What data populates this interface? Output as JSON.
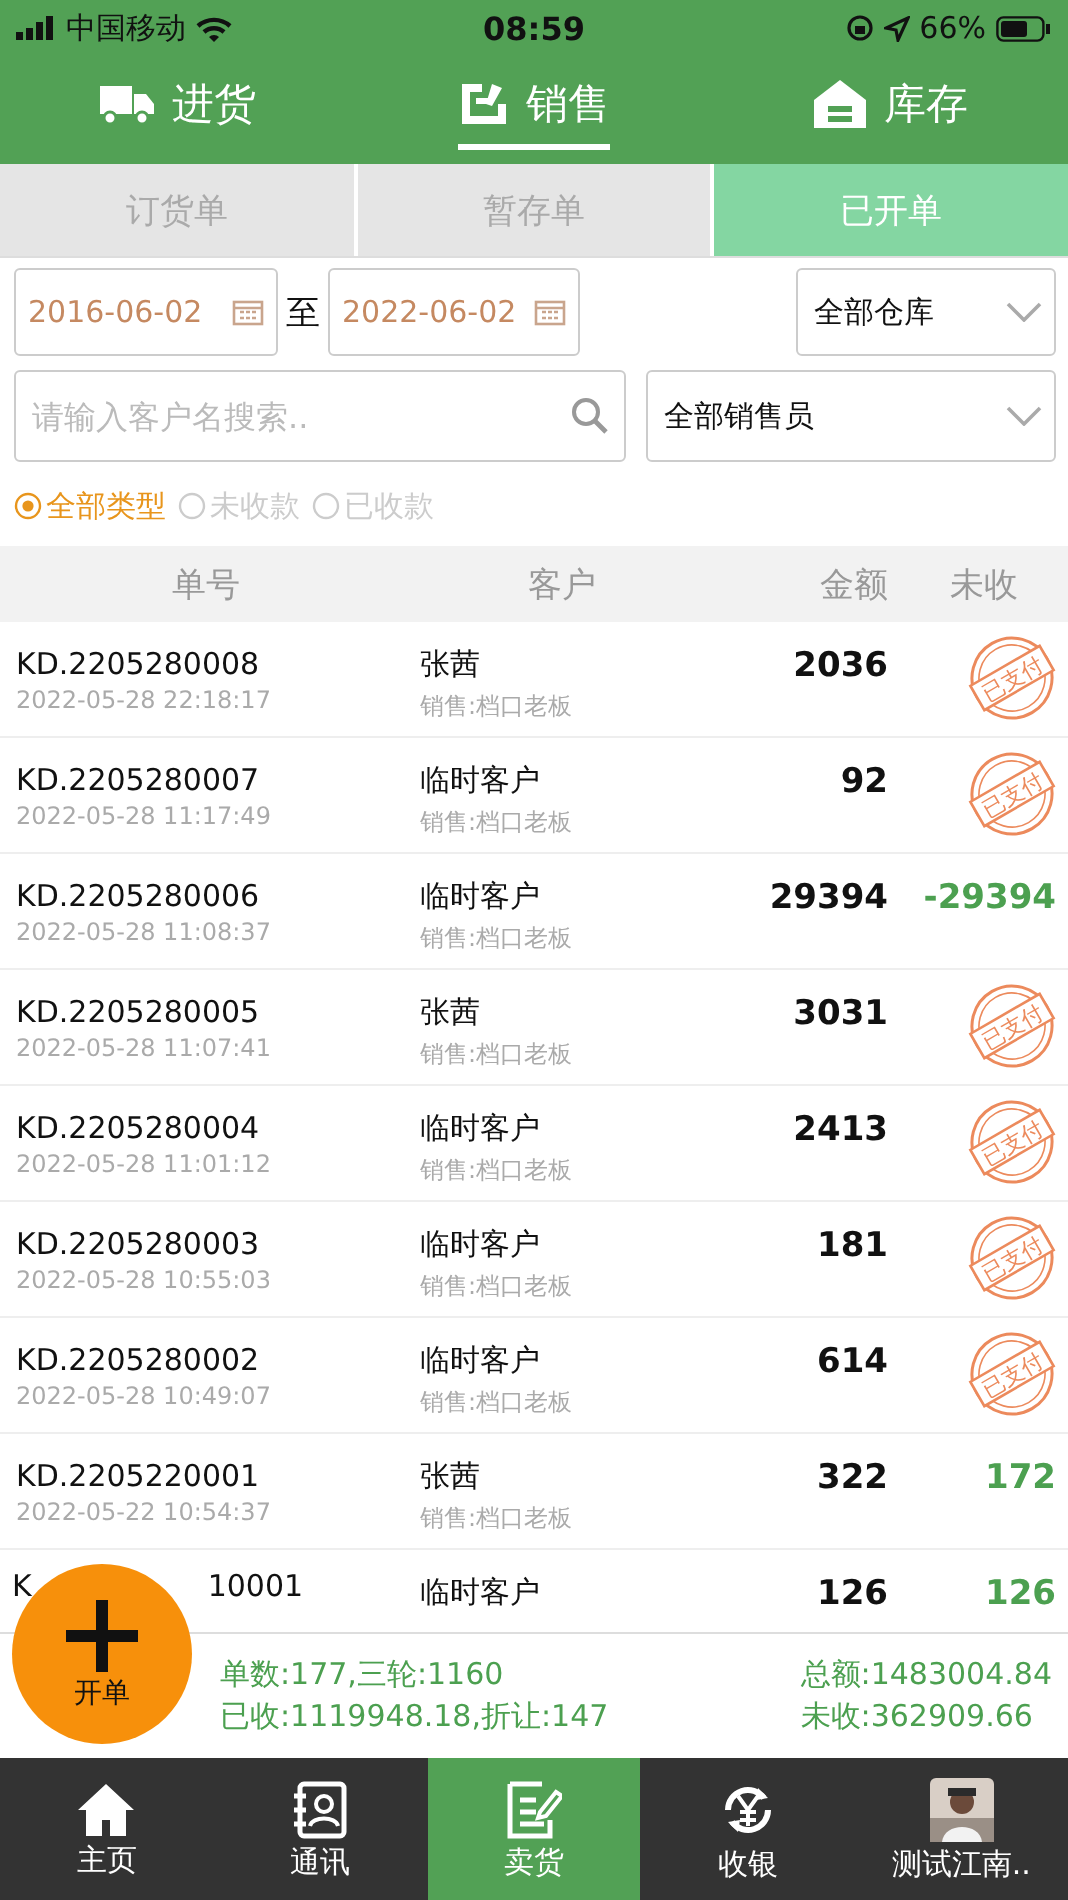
{
  "status_bar": {
    "carrier": "中国移动",
    "time": "08:59",
    "battery": "66%"
  },
  "top_tabs": [
    {
      "label": "进货",
      "selected": false
    },
    {
      "label": "销售",
      "selected": true
    },
    {
      "label": "库存",
      "selected": false
    }
  ],
  "sub_tabs": [
    {
      "label": "订货单",
      "selected": false
    },
    {
      "label": "暂存单",
      "selected": false
    },
    {
      "label": "已开单",
      "selected": true
    }
  ],
  "filters": {
    "date_from": "2016-06-02",
    "date_sep": "至",
    "date_to": "2022-06-02",
    "warehouse": "全部仓库",
    "search": {
      "placeholder": "请输入客户名搜索.."
    },
    "salesperson": "全部销售员"
  },
  "type_options": [
    {
      "label": "全部类型",
      "selected": true
    },
    {
      "label": "未收款",
      "selected": false
    },
    {
      "label": "已收款",
      "selected": false
    }
  ],
  "table": {
    "columns": [
      "单号",
      "客户",
      "金额",
      "未收"
    ],
    "rows": [
      {
        "order": "KD.2205280008",
        "time": "2022-05-28 22:18:17",
        "customer": "张茜",
        "seller": "销售:档口老板",
        "amount": "2036",
        "unpaid": {
          "kind": "stamp",
          "text": "已支付"
        }
      },
      {
        "order": "KD.2205280007",
        "time": "2022-05-28 11:17:49",
        "customer": "临时客户",
        "seller": "销售:档口老板",
        "amount": "92",
        "unpaid": {
          "kind": "stamp",
          "text": "已支付"
        }
      },
      {
        "order": "KD.2205280006",
        "time": "2022-05-28 11:08:37",
        "customer": "临时客户",
        "seller": "销售:档口老板",
        "amount": "29394",
        "unpaid": {
          "kind": "amount",
          "text": "-29394"
        }
      },
      {
        "order": "KD.2205280005",
        "time": "2022-05-28 11:07:41",
        "customer": "张茜",
        "seller": "销售:档口老板",
        "amount": "3031",
        "unpaid": {
          "kind": "stamp",
          "text": "已支付"
        }
      },
      {
        "order": "KD.2205280004",
        "time": "2022-05-28 11:01:12",
        "customer": "临时客户",
        "seller": "销售:档口老板",
        "amount": "2413",
        "unpaid": {
          "kind": "stamp",
          "text": "已支付"
        }
      },
      {
        "order": "KD.2205280003",
        "time": "2022-05-28 10:55:03",
        "customer": "临时客户",
        "seller": "销售:档口老板",
        "amount": "181",
        "unpaid": {
          "kind": "stamp",
          "text": "已支付"
        }
      },
      {
        "order": "KD.2205280002",
        "time": "2022-05-28 10:49:07",
        "customer": "临时客户",
        "seller": "销售:档口老板",
        "amount": "614",
        "unpaid": {
          "kind": "stamp",
          "text": "已支付"
        }
      },
      {
        "order": "KD.2205220001",
        "time": "2022-05-22 10:54:37",
        "customer": "张茜",
        "seller": "销售:档口老板",
        "amount": "322",
        "unpaid": {
          "kind": "amount",
          "text": "172"
        }
      },
      {
        "order_parts": [
          "K",
          "10001"
        ],
        "customer": "临时客户",
        "amount": "126",
        "unpaid": {
          "kind": "amount",
          "text": "126"
        }
      }
    ]
  },
  "fab": {
    "label": "开单"
  },
  "summary": {
    "left": [
      "单数:177,三轮:1160",
      "已收:1119948.18,折让:147"
    ],
    "right": [
      "总额:1483004.84",
      "未收:362909.66"
    ]
  },
  "bottom_nav": [
    {
      "label": "主页",
      "selected": false
    },
    {
      "label": "通讯",
      "selected": false
    },
    {
      "label": "卖货",
      "selected": true
    },
    {
      "label": "收银",
      "selected": false
    },
    {
      "label": "测试江南..",
      "selected": false
    }
  ]
}
